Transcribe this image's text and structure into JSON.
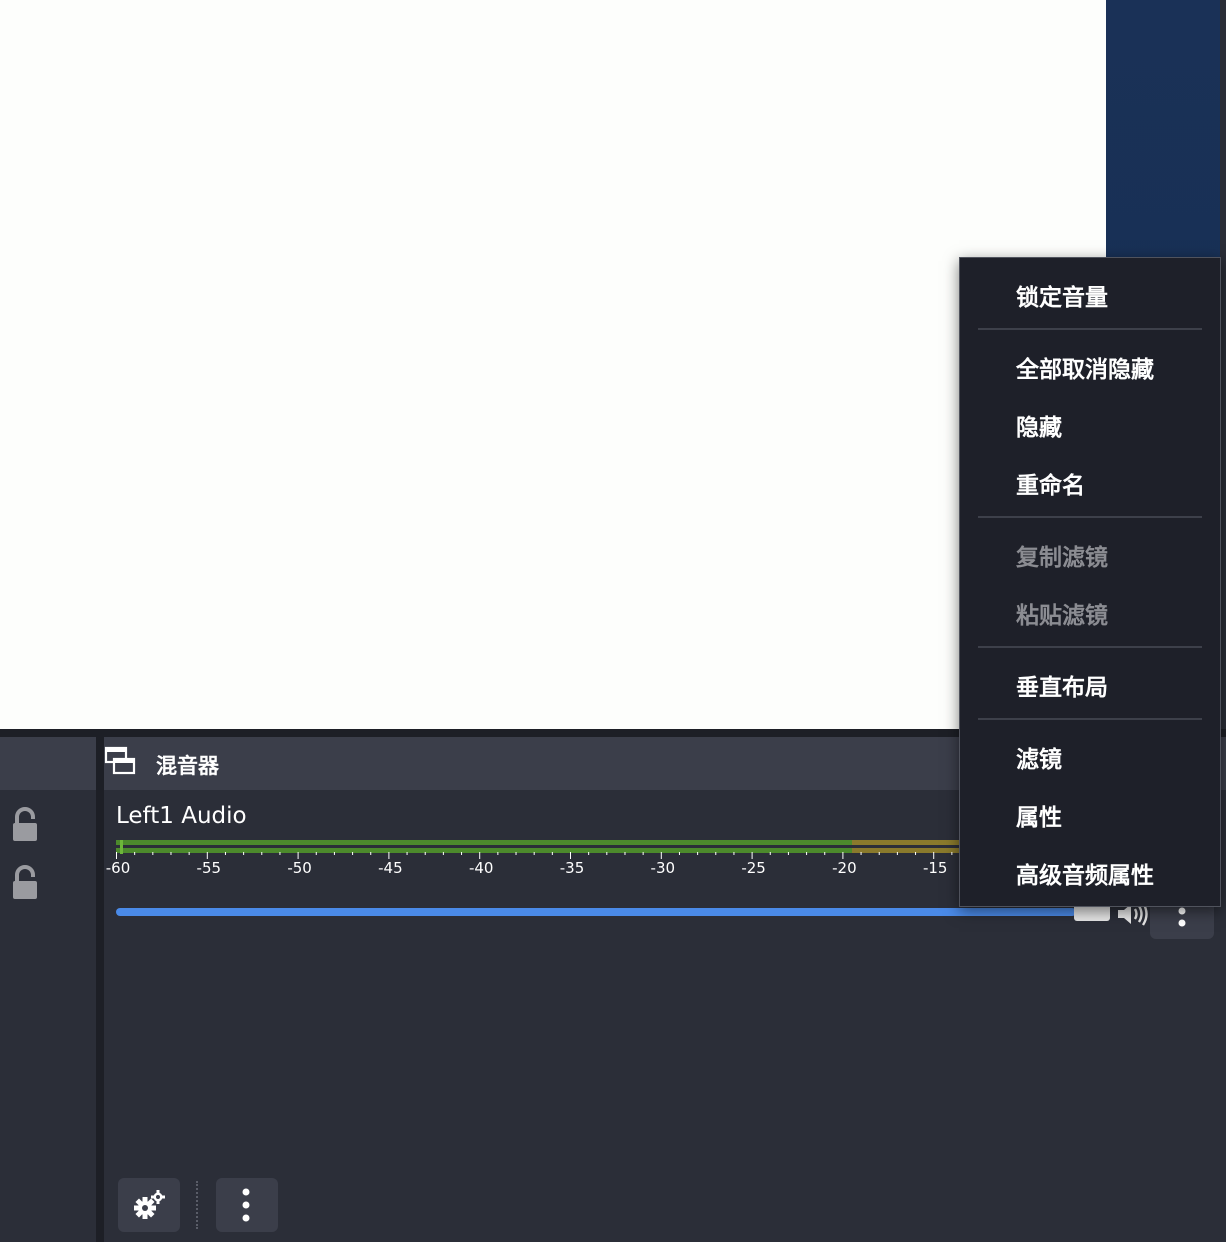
{
  "mixer": {
    "title": "混音器",
    "channel": {
      "name": "Left1 Audio",
      "meter_ticks": [
        "-60",
        "-55",
        "-50",
        "-45",
        "-40",
        "-35",
        "-30",
        "-25",
        "-20",
        "-15"
      ],
      "volume_fraction": 0.97
    }
  },
  "context_menu": {
    "items": [
      {
        "label": "锁定音量",
        "enabled": true
      },
      {
        "label": "全部取消隐藏",
        "enabled": true
      },
      {
        "label": "隐藏",
        "enabled": true
      },
      {
        "label": "重命名",
        "enabled": true
      },
      {
        "label": "复制滤镜",
        "enabled": false
      },
      {
        "label": "粘贴滤镜",
        "enabled": false
      },
      {
        "label": "垂直布局",
        "enabled": true
      },
      {
        "label": "滤镜",
        "enabled": true
      },
      {
        "label": "属性",
        "enabled": true
      },
      {
        "label": "高级音频属性",
        "enabled": true
      }
    ]
  },
  "colors": {
    "accent": "#4a8ae8",
    "panel_bg": "#2b2e38",
    "header_bg": "#3b3e4a",
    "menu_bg": "#1e2029",
    "meter_green": "#4c8a2c",
    "meter_yellow": "#8a7a2c"
  },
  "icons": {
    "lock": "lock-icon",
    "dock_float": "dock-float-icon",
    "speaker": "speaker-icon",
    "gear": "gear-icon",
    "more": "vertical-dots-icon"
  }
}
